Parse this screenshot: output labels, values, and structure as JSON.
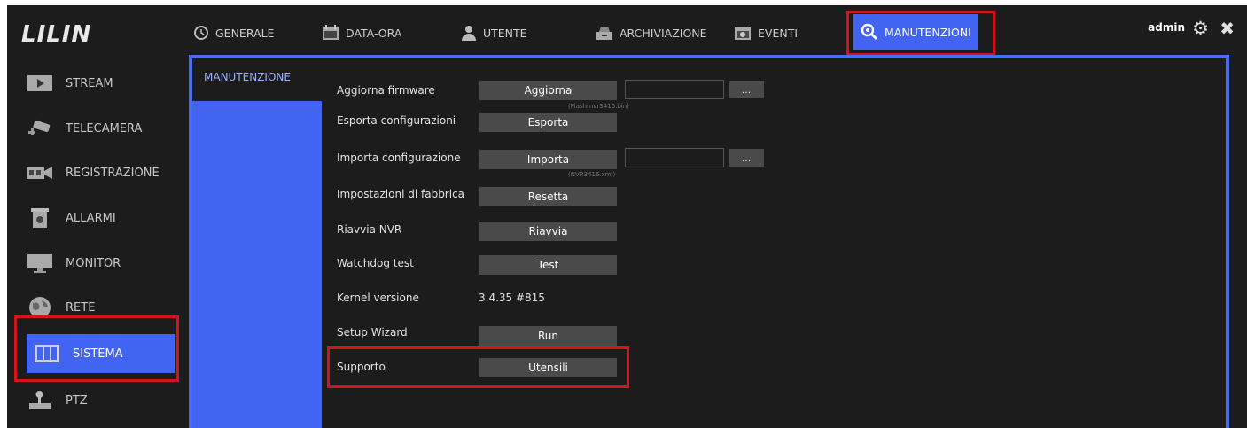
{
  "app": {
    "logo": "LILIN",
    "user": "admin"
  },
  "topnav": {
    "tabs": [
      {
        "label": "GENERALE",
        "icon": "clock-icon"
      },
      {
        "label": "DATA-ORA",
        "icon": "calendar-icon"
      },
      {
        "label": "UTENTE",
        "icon": "user-icon"
      },
      {
        "label": "ARCHIVIAZIONE",
        "icon": "storage-icon"
      },
      {
        "label": "EVENTI",
        "icon": "event-icon"
      },
      {
        "label": "MANUTENZIONI",
        "icon": "maintenance-icon"
      }
    ]
  },
  "sidebar": {
    "items": [
      {
        "label": "STREAM",
        "icon": "stream-icon"
      },
      {
        "label": "TELECAMERA",
        "icon": "camera-icon"
      },
      {
        "label": "REGISTRAZIONE",
        "icon": "recorder-icon"
      },
      {
        "label": "ALLARMI",
        "icon": "alarm-icon"
      },
      {
        "label": "MONITOR",
        "icon": "monitor-icon"
      },
      {
        "label": "RETE",
        "icon": "globe-icon"
      },
      {
        "label": "SISTEMA",
        "icon": "system-icon"
      },
      {
        "label": "PTZ",
        "icon": "joystick-icon"
      }
    ]
  },
  "subnav": {
    "label": "MANUTENZIONE"
  },
  "rows": {
    "firmware": {
      "label": "Aggiorna firmware",
      "button": "Aggiorna",
      "note": "(Flashrnvr3416.bin)"
    },
    "export": {
      "label": "Esporta configurazioni",
      "button": "Esporta"
    },
    "import": {
      "label": "Importa configurazione",
      "button": "Importa",
      "note": "(NVR3416.xml)"
    },
    "factory": {
      "label": "Impostazioni di fabbrica",
      "button": "Resetta"
    },
    "reboot": {
      "label": "Riavvia NVR",
      "button": "Riavvia"
    },
    "watchdog": {
      "label": "Watchdog test",
      "button": "Test"
    },
    "kernel": {
      "label": "Kernel versione",
      "value": "3.4.35 #815"
    },
    "wizard": {
      "label": "Setup Wizard",
      "button": "Run"
    },
    "support": {
      "label": "Supporto",
      "button": "Utensili"
    },
    "browse_label": "..."
  },
  "colors": {
    "accent": "#4264f2",
    "highlight": "#d3141c",
    "background": "#1c1c1c"
  }
}
